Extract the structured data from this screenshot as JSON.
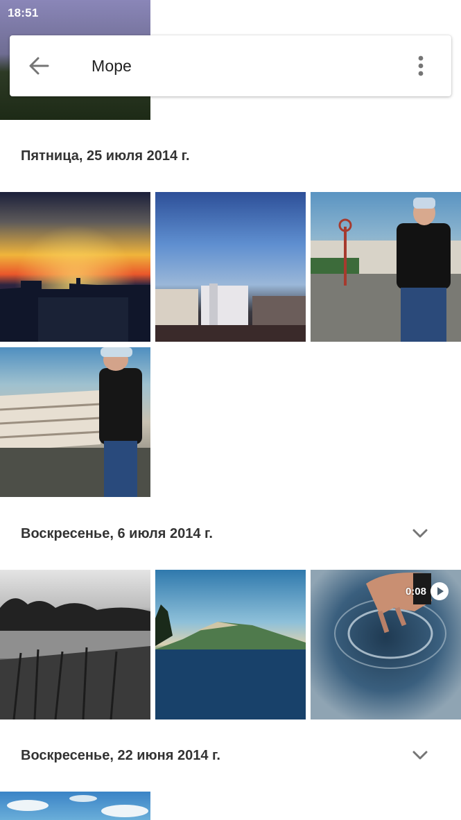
{
  "status_bar": {
    "time": "18:51"
  },
  "app_bar": {
    "title": "Море",
    "back_icon": "arrow-back-icon",
    "menu_icon": "more-vert-icon"
  },
  "sections": [
    {
      "date": "Пятница, 25 июля 2014 г.",
      "collapsible": false
    },
    {
      "date": "Воскресенье, 6 июля 2014 г.",
      "collapsible": true
    },
    {
      "date": "Воскресенье, 22 июня 2014 г.",
      "collapsible": true
    }
  ],
  "video": {
    "duration": "0:08",
    "play_icon": "play-circle-icon"
  },
  "colors": {
    "accent": "#ffffff",
    "text_primary": "#212121",
    "header_text": "#333333",
    "icon_gray": "#757575"
  }
}
